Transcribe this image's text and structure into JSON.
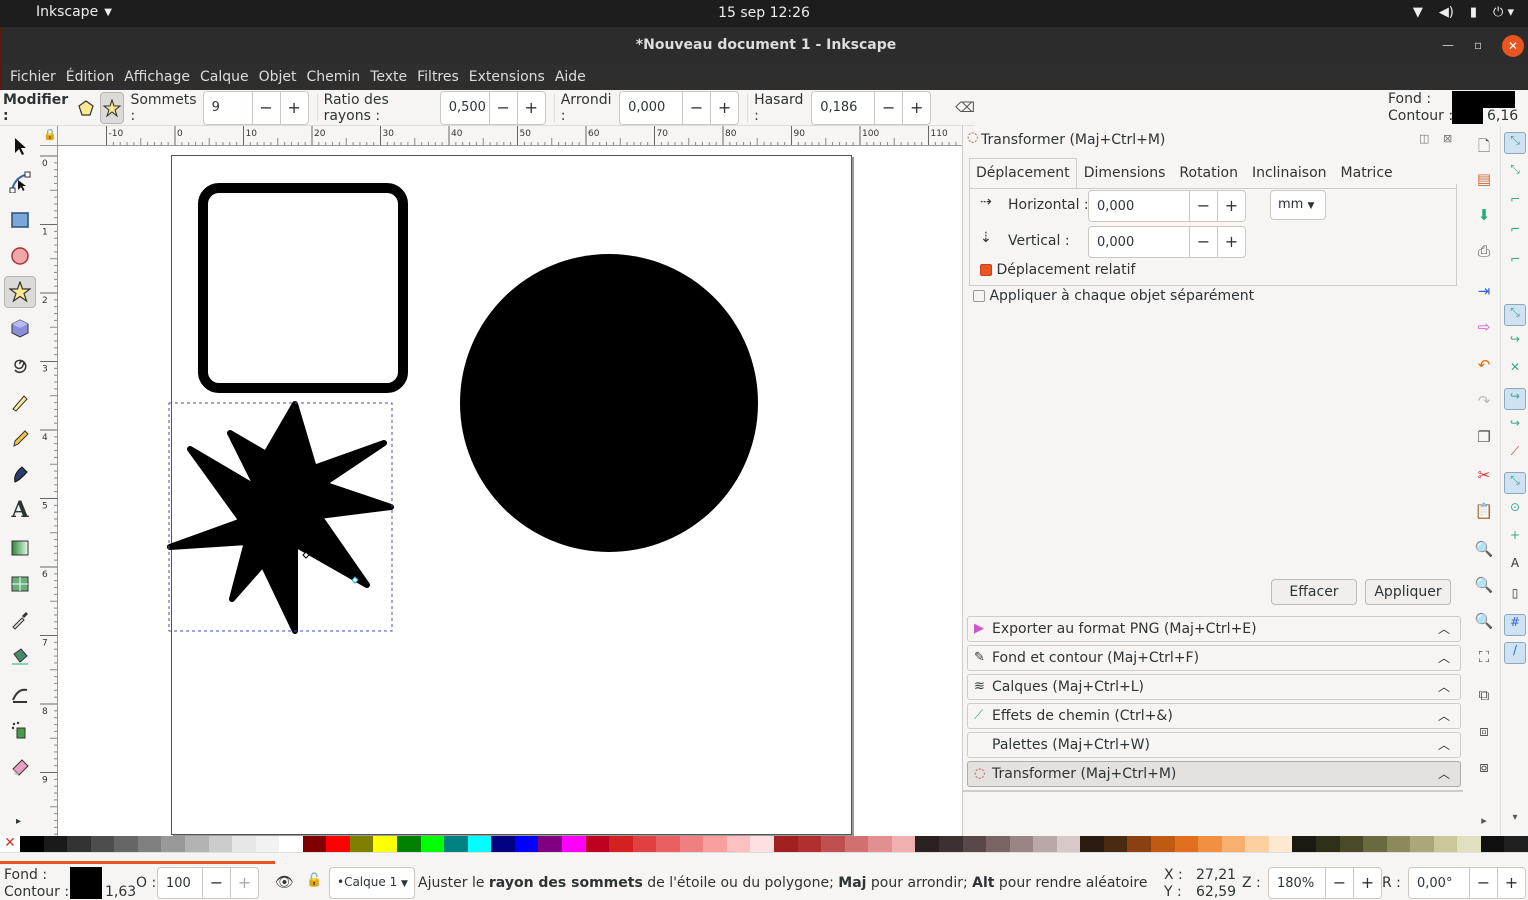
{
  "system": {
    "app_menu": "Inkscape",
    "clock": "15 sep  12:26"
  },
  "window": {
    "title": "*Nouveau document 1 - Inkscape"
  },
  "menu": [
    "Fichier",
    "Édition",
    "Affichage",
    "Calque",
    "Objet",
    "Chemin",
    "Texte",
    "Filtres",
    "Extensions",
    "Aide"
  ],
  "toolctl": {
    "modifier_label": "Modifier :",
    "sommets_label": "Sommets :",
    "sommets": "9",
    "ratio_label": "Ratio des rayons :",
    "ratio": "0,500",
    "arrondi_label": "Arrondi :",
    "arrondi": "0,000",
    "hasard_label": "Hasard :",
    "hasard": "0,186"
  },
  "style_indicator": {
    "fond_label": "Fond :",
    "contour_label": "Contour :",
    "contour_width": "6,16"
  },
  "ruler_top": [
    "-10",
    "0",
    "10",
    "20",
    "30",
    "40",
    "50",
    "60",
    "70",
    "80",
    "90",
    "100",
    "110"
  ],
  "ruler_left": [
    "0",
    "1",
    "2",
    "3",
    "4",
    "5",
    "6",
    "7",
    "8",
    "9"
  ],
  "transform_panel": {
    "title": "Transformer (Maj+Ctrl+M)",
    "tabs": [
      "Déplacement",
      "Dimensions",
      "Rotation",
      "Inclinaison",
      "Matrice"
    ],
    "horizontal_label": "Horizontal :",
    "horizontal": "0,000",
    "vertical_label": "Vertical :",
    "vertical": "0,000",
    "unit": "mm",
    "relative_label": "Déplacement relatif",
    "apply_each_label": "Appliquer à chaque objet séparément",
    "clear_label": "Effacer",
    "apply_label": "Appliquer"
  },
  "docked_panels": [
    "Exporter au format PNG (Maj+Ctrl+E)",
    "Fond et contour (Maj+Ctrl+F)",
    "Calques (Maj+Ctrl+L)",
    "Effets de chemin (Ctrl+&)",
    "Palettes (Maj+Ctrl+W)",
    "Transformer (Maj+Ctrl+M)"
  ],
  "palette": [
    "#000000",
    "#1a1a1a",
    "#333333",
    "#4d4d4d",
    "#666666",
    "#808080",
    "#999999",
    "#b3b3b3",
    "#cccccc",
    "#e6e6e6",
    "#f2f2f2",
    "#ffffff",
    "#800000",
    "#ff0000",
    "#808000",
    "#ffff00",
    "#008000",
    "#00ff00",
    "#008080",
    "#00ffff",
    "#000080",
    "#0000ff",
    "#800080",
    "#ff00ff",
    "#c00020",
    "#d42020",
    "#e04040",
    "#e86060",
    "#f08080",
    "#f8a0a0",
    "#fcc0c0",
    "#ffe0e0",
    "#a02020",
    "#b03030",
    "#c05050",
    "#d07070",
    "#e09090",
    "#f0b0b0",
    "#2a2020",
    "#3d3030",
    "#5a4848",
    "#7a6464",
    "#9a8484",
    "#baa8a8",
    "#d8c8c8",
    "#2a1a10",
    "#4a2a10",
    "#8a4010",
    "#c05a10",
    "#e07020",
    "#f09040",
    "#f8b070",
    "#fcd0a0",
    "#fee8d0",
    "#1a1a10",
    "#30301a",
    "#4a4a2a",
    "#6a6a40",
    "#8a8a5a",
    "#a8a878",
    "#c8c898",
    "#e0e0c0",
    "#101010",
    "#202020"
  ],
  "status": {
    "fond_label": "Fond :",
    "contour_label": "Contour :",
    "contour_width": "1,63",
    "o_label": "O :",
    "opacity": "100",
    "layer": "•Calque 1",
    "message_parts": [
      "Ajuster le ",
      "rayon des sommets",
      " de l'étoile ou du polygone; ",
      "Maj",
      " pour arrondir; ",
      "Alt",
      " pour rendre aléatoire"
    ],
    "x_label": "X :",
    "x": "27,21",
    "y_label": "Y :",
    "y": "62,59",
    "z_label": "Z :",
    "zoom": "180%",
    "r_label": "R :",
    "rotation": "0,00°"
  },
  "colors": {
    "accent": "#e95420",
    "selection": "#4a4ad0"
  }
}
